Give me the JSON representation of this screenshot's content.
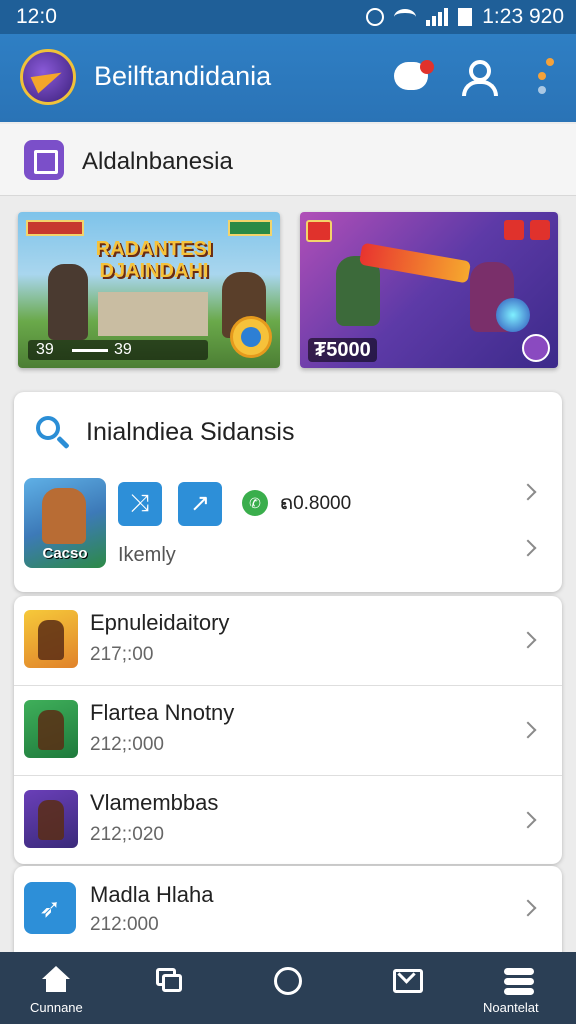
{
  "status_bar": {
    "time_left": "12:0",
    "time_right": "1:23 920"
  },
  "header": {
    "title": "Beilftandidania",
    "icons": [
      "app-logo",
      "chat-icon",
      "profile-icon",
      "more-icon"
    ],
    "accent_color": "#2a73b6"
  },
  "section": {
    "title": "Aldalnbanesia",
    "icon": "folder-icon"
  },
  "banners": [
    {
      "title": "RADANTESI DJAINDAHI",
      "score_a": "39",
      "score_b": "39"
    },
    {
      "score": "₮5000"
    }
  ],
  "search_card": {
    "label": "Inialndiea Sidansis",
    "thumb_label": "Cacso",
    "price": "ຄ0.8000",
    "subtitle": "Ikemly"
  },
  "game_list": [
    {
      "name": "Epnuleidaitory",
      "count": "217;:00"
    },
    {
      "name": "Flartea Nnotny",
      "count": "212;:000"
    },
    {
      "name": "Vlamembbas",
      "count": "212;:020"
    },
    {
      "name": "Madla Hlaha",
      "count": "212:000"
    }
  ],
  "bottom_nav": [
    {
      "label": "Cunnane",
      "icon": "home-icon"
    },
    {
      "label": "",
      "icon": "windows-icon"
    },
    {
      "label": "",
      "icon": "chat-circle-icon"
    },
    {
      "label": "",
      "icon": "mail-icon"
    },
    {
      "label": "Noantelat",
      "icon": "menu-stack-icon"
    }
  ]
}
